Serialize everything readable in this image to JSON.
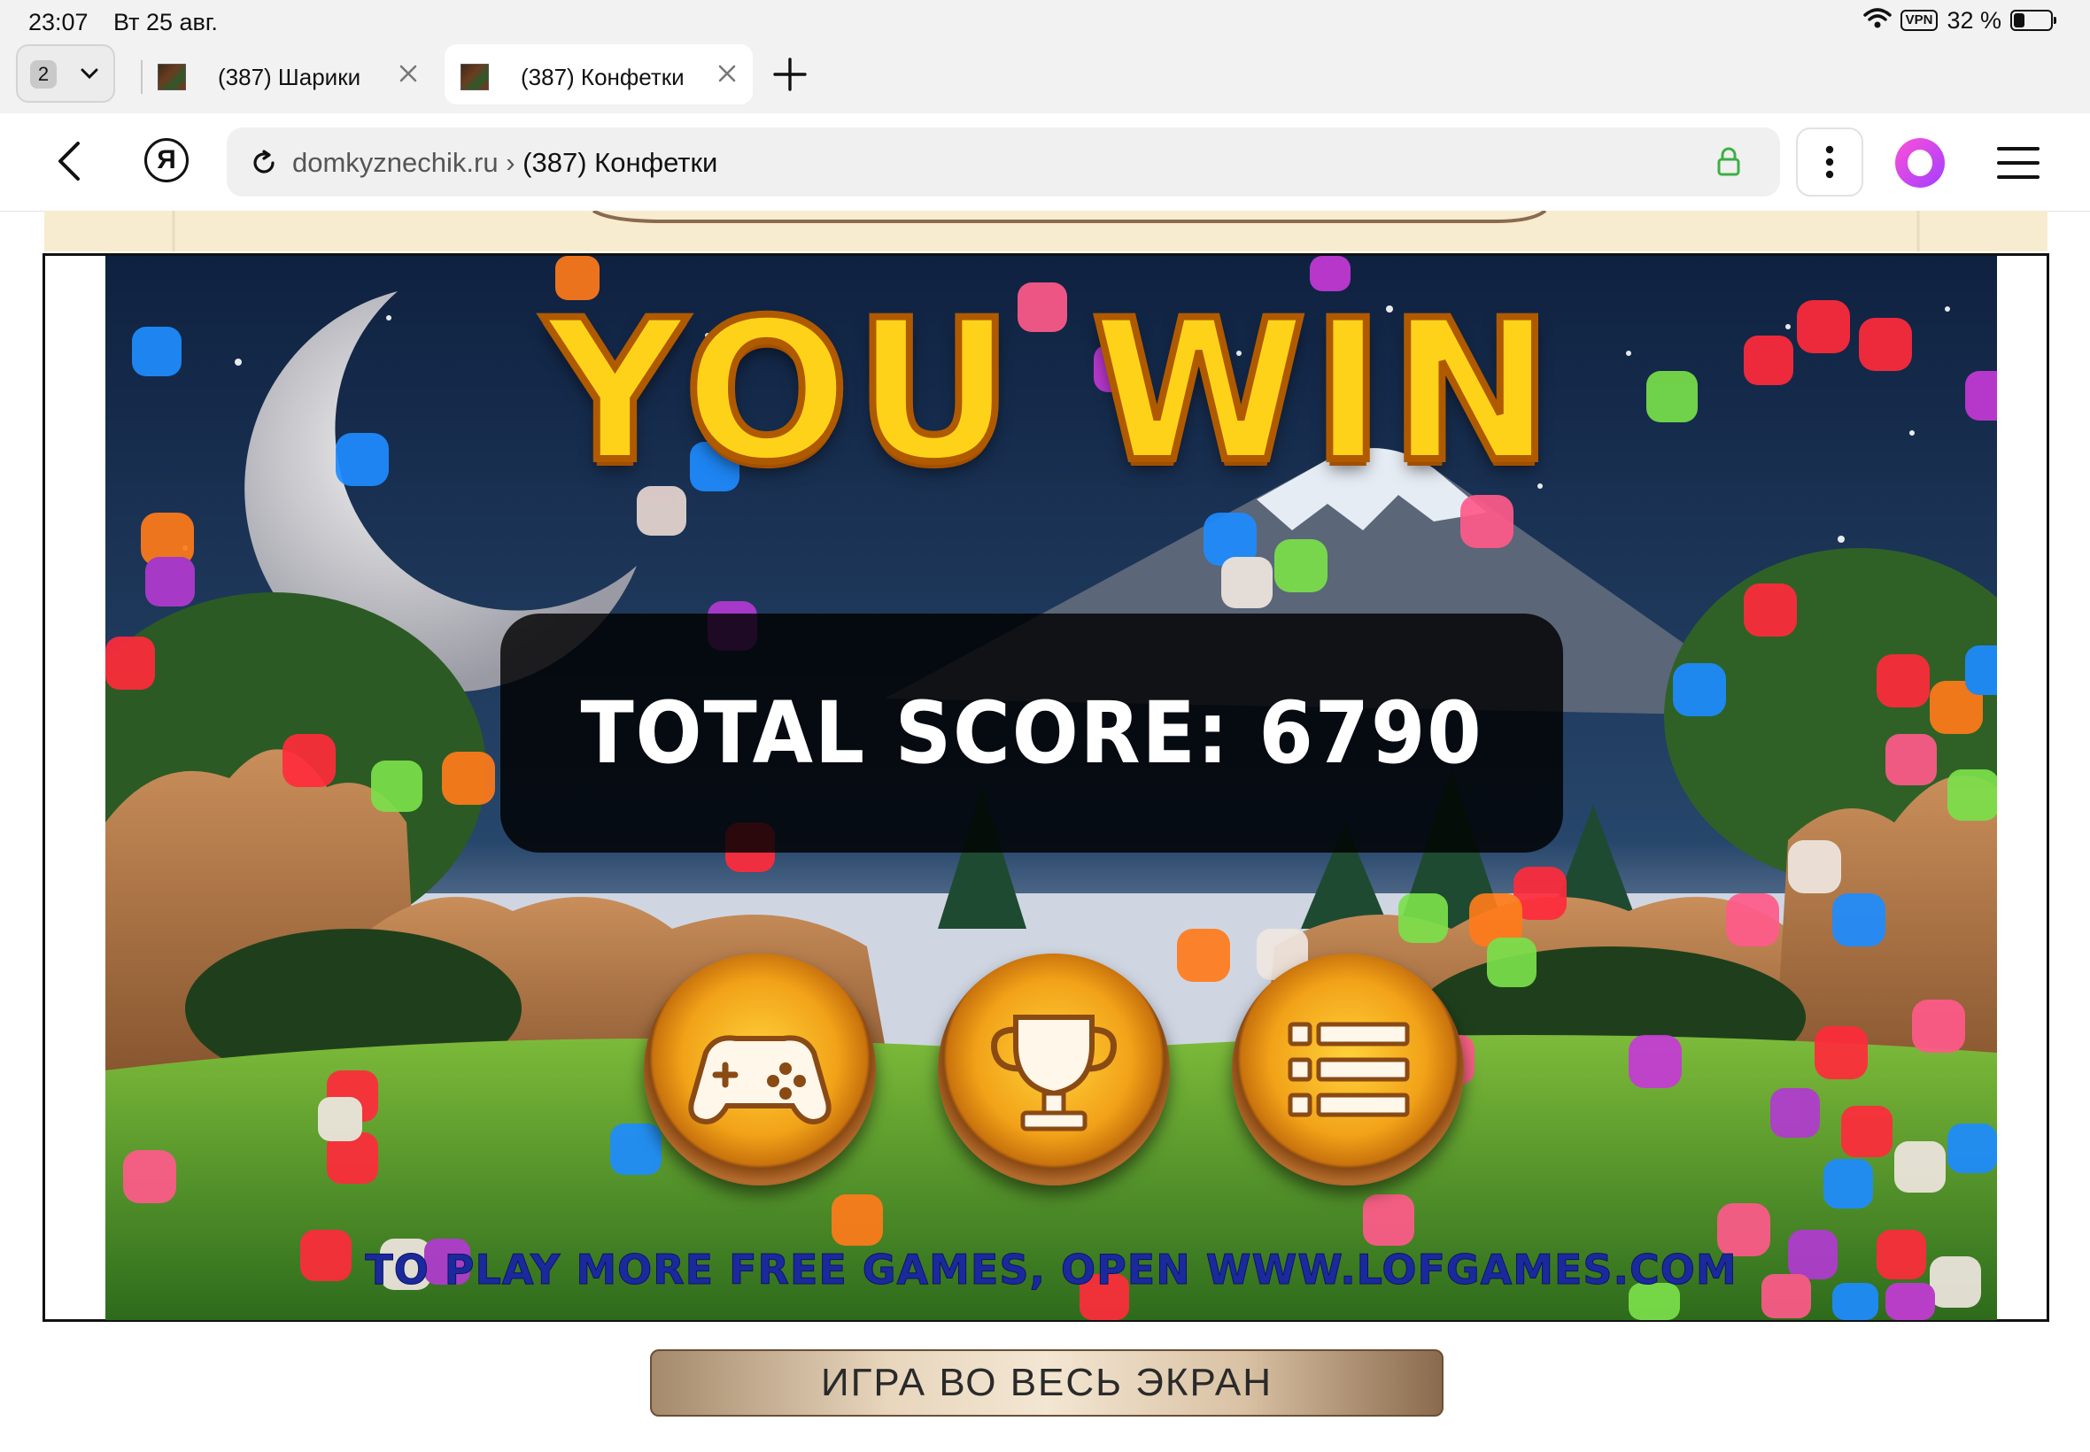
{
  "status_bar": {
    "time": "23:07",
    "date": "Вт 25 авг.",
    "vpn": "VPN",
    "battery_text": "32 %",
    "battery_level": 0.32
  },
  "tabs": {
    "count": "2",
    "items": [
      {
        "title": "(387) Шарики",
        "active": false
      },
      {
        "title": "(387) Конфетки",
        "active": true
      }
    ]
  },
  "address_bar": {
    "domain": "domkyznechik.ru",
    "separator": "›",
    "page_title": "(387) Конфетки",
    "yandex_letter": "Я"
  },
  "game": {
    "title": "YOU WIN",
    "score_label": "TOTAL SCORE: 6790",
    "buttons": [
      "gamepad-icon",
      "trophy-icon",
      "menu-list-icon"
    ],
    "promo": "TO PLAY MORE FREE GAMES, OPEN WWW.LOFGAMES.COM"
  },
  "fullscreen_button": "ИГРА ВО ВЕСЬ ЭКРАН",
  "colors": {
    "title_yellow": "#ffd21a",
    "promo_blue": "#1a2a9c",
    "button_gold": "#f2a218"
  }
}
